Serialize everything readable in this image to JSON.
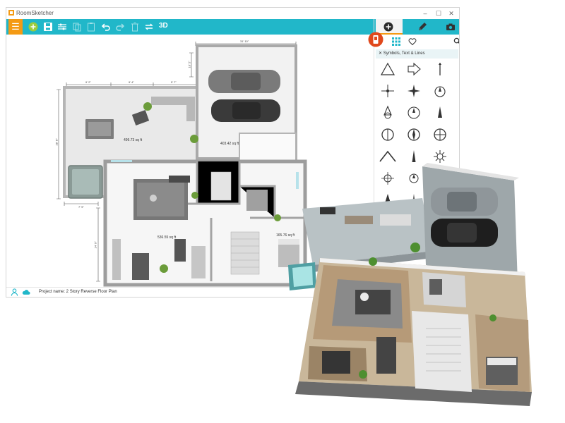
{
  "app": {
    "title": "RoomSketcher",
    "window_controls": [
      "–",
      "☐",
      "✕"
    ]
  },
  "toolbar": {
    "menu_icon": "hamburger-menu-icon",
    "tools": [
      "new-plan-icon",
      "save-icon",
      "settings-icon",
      "copy-icon",
      "paste-icon",
      "undo-icon",
      "redo-icon",
      "delete-icon",
      "flip-icon"
    ],
    "view_3d_label": "3D",
    "accent_color": "#21b7c9",
    "menu_color": "#f49a14"
  },
  "right_panel": {
    "tabs": [
      "plus-icon",
      "pencil-icon",
      "camera-icon"
    ],
    "category_title": "Symbols, Text & Lines",
    "symbols": [
      "triangle-symbol",
      "arrow-symbol",
      "north-line-symbol",
      "compass-rose-symbol",
      "compass-star-symbol",
      "north-circle-symbol",
      "north-arrow-symbol",
      "compass-circle-symbol",
      "north-needle-symbol",
      "compass-symbol-1",
      "compass-symbol-2",
      "compass-symbol-3",
      "chevron-symbol",
      "needle-symbol",
      "sunburst-symbol",
      "sun-compass-symbol",
      "sun-compass-symbol-2",
      "n-symbol",
      "n-arrow-symbol",
      "n-needle-symbol"
    ]
  },
  "floorplan": {
    "areas": {
      "terrace": "499.73 sq ft",
      "garage": "403.42 sq ft",
      "living": "536.55 sq ft",
      "bedroom": "165.76 sq ft"
    },
    "dimensions": {
      "top_overall": "31' 10\"",
      "seg1": "9' 2\"",
      "seg2": "9' 4\"",
      "seg3": "5' 7\"",
      "left_side": "28' 8\"",
      "left_lower": "14' 9\"",
      "bottom_left": "7' 9\"",
      "garage_side": "10' 5\""
    }
  },
  "status": {
    "project_name": "Project name: 2 Story Reverse Floor Plan"
  }
}
